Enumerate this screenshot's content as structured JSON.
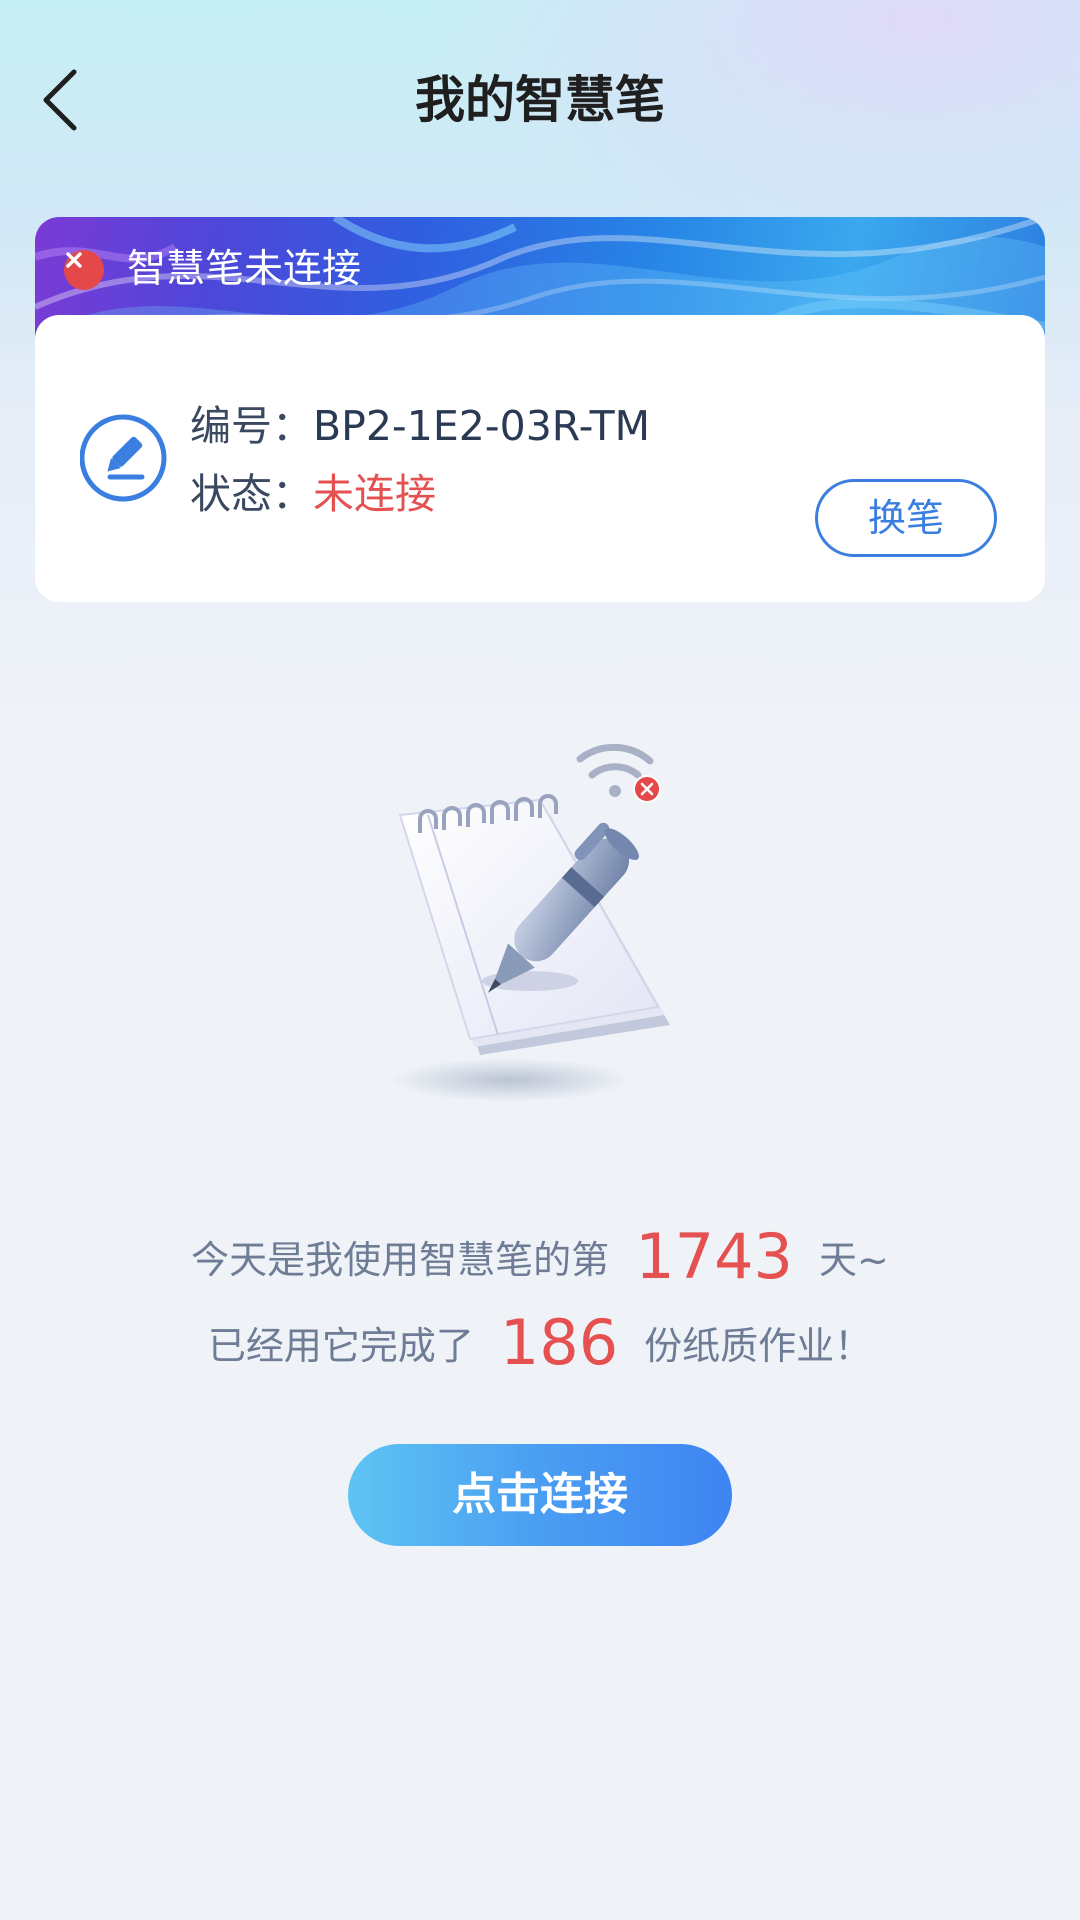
{
  "header": {
    "title": "我的智慧笔"
  },
  "status_card": {
    "banner_text": "智慧笔未连接",
    "serial_label": "编号：",
    "serial_value": "BP2-1E2-03R-TM",
    "status_label": "状态：",
    "status_value": "未连接",
    "swap_button": "换笔"
  },
  "stats": {
    "days_prefix": "今天是我使用智慧笔的第",
    "days_count": "1743",
    "days_suffix": "天~",
    "homework_prefix": "已经用它完成了",
    "homework_count": "186",
    "homework_suffix": "份纸质作业！"
  },
  "connect_button": "点击连接",
  "colors": {
    "accent_blue": "#3a7ee0",
    "status_red": "#e55050",
    "error_badge": "#e54848"
  },
  "icons": {
    "back": "chevron-left-icon",
    "banner_status": "close-circle-icon",
    "pen_badge": "pen-edit-icon",
    "wifi": "wifi-off-icon"
  }
}
